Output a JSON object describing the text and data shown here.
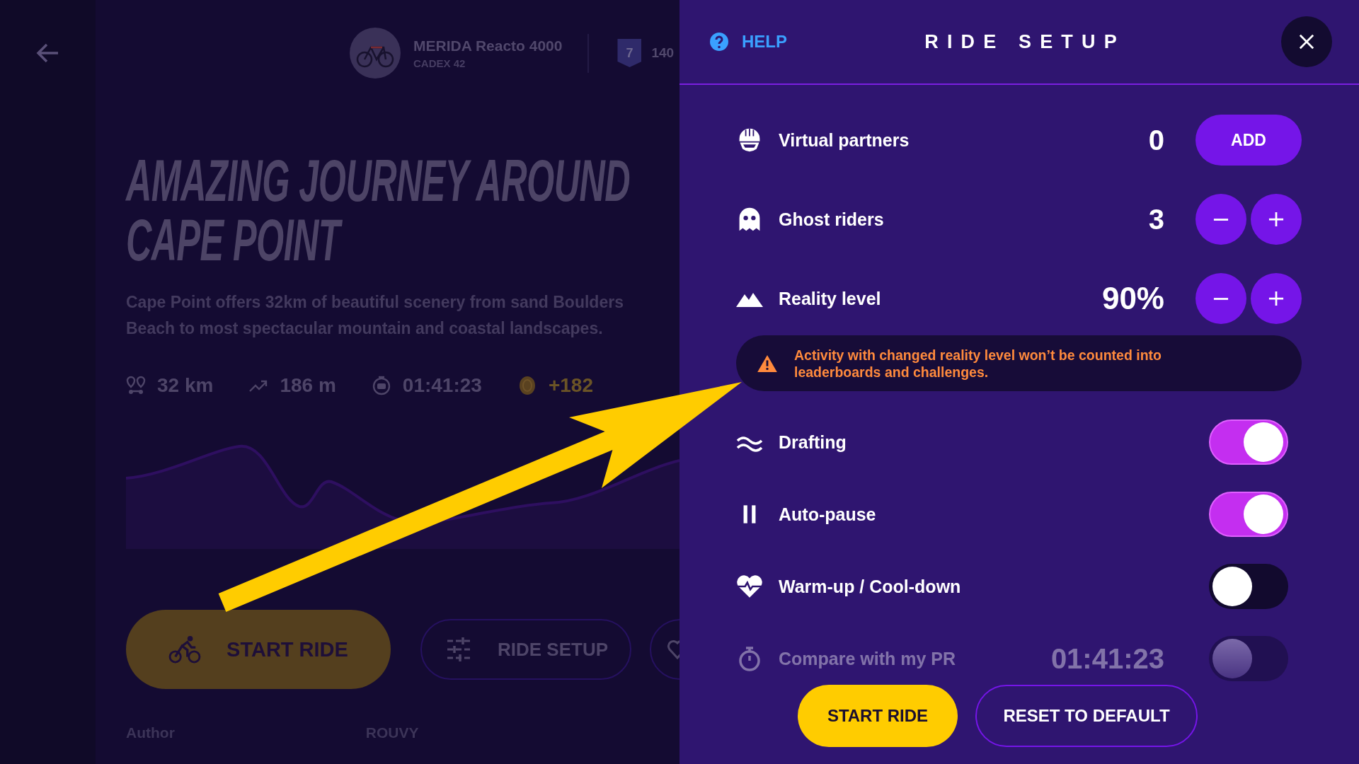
{
  "route_page": {
    "bike": {
      "name": "MERIDA Reacto 4000",
      "wheels": "CADEX 42"
    },
    "level_badge": "7",
    "points": "140",
    "title_lines": [
      "AMAZING JOURNEY AROUND",
      "CAPE POINT"
    ],
    "description": "Cape Point offers 32km of beautiful scenery from sand Boulders Beach to most spectacular mountain and coastal landscapes.",
    "stats": [
      {
        "kind": "distance",
        "text": "32 km"
      },
      {
        "kind": "elevation",
        "text": "186 m"
      },
      {
        "kind": "best_time",
        "text": "01:41:23"
      },
      {
        "kind": "reward",
        "text": "+182"
      }
    ],
    "buttons": [
      {
        "kind": "start",
        "label": "START RIDE"
      },
      {
        "kind": "setup",
        "label": "RIDE SETUP"
      },
      {
        "kind": "favorite"
      }
    ],
    "footer": [
      "Author",
      "ROUVY"
    ]
  },
  "ride_setup": {
    "help": "HELP",
    "title": "RIDE SETUP",
    "counters": [
      {
        "kind": "add",
        "label": "Virtual partners",
        "value": "0",
        "button": "ADD"
      },
      {
        "kind": "stepper",
        "label": "Ghost riders",
        "value": "3"
      },
      {
        "kind": "stepper",
        "label": "Reality level",
        "value": "90%"
      }
    ],
    "warning": "Activity with changed reality level won’t be counted into leaderboards and challenges.",
    "toggles": [
      {
        "label": "Drafting",
        "on": true,
        "disabled": false
      },
      {
        "label": "Auto-pause",
        "on": true,
        "disabled": false
      },
      {
        "label": "Warm-up / Cool-down",
        "on": false,
        "disabled": false
      },
      {
        "label": "Compare with my PR",
        "value": "01:41:23",
        "on": false,
        "disabled": true
      }
    ],
    "actions": [
      {
        "kind": "primary",
        "label": "START RIDE"
      },
      {
        "kind": "secondary",
        "label": "RESET TO DEFAULT"
      }
    ]
  }
}
